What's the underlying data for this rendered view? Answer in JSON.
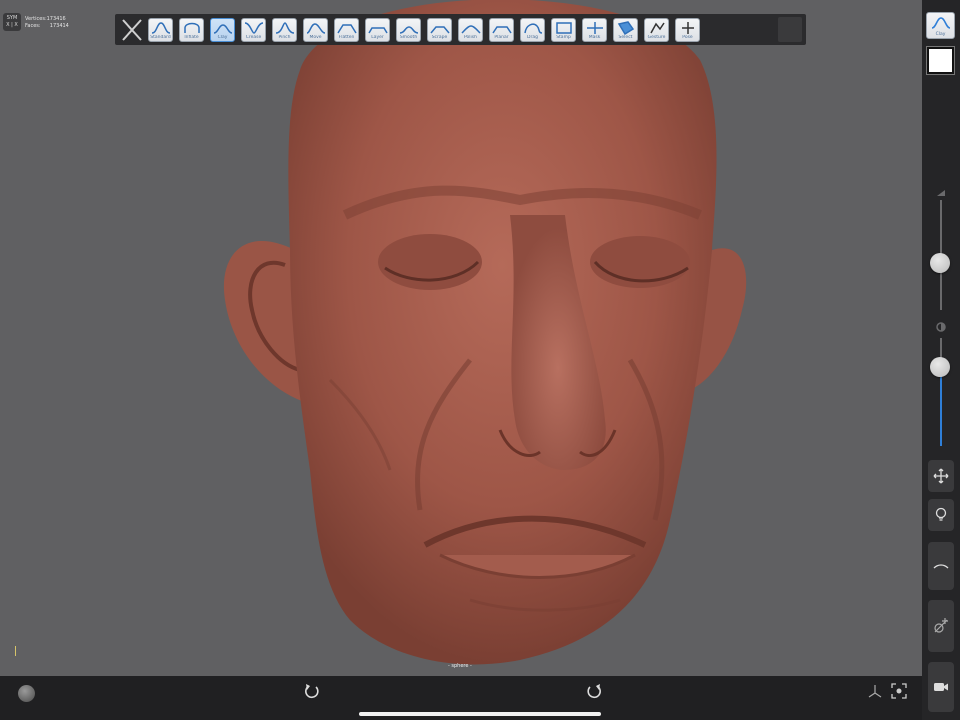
{
  "status": {
    "sym_label": "SYM",
    "sym_axes": "X | X",
    "vertices_label": "Vertices:",
    "vertices_value": "173416",
    "faces_label": "Faces:",
    "faces_value": "173414"
  },
  "toolbar": {
    "tools": [
      {
        "label": "Standard",
        "icon": "standard-curve-icon"
      },
      {
        "label": "Inflate",
        "icon": "inflate-curve-icon"
      },
      {
        "label": "Clay",
        "icon": "clay-curve-icon",
        "active": true
      },
      {
        "label": "Crease",
        "icon": "crease-curve-icon"
      },
      {
        "label": "Pinch",
        "icon": "pinch-curve-icon"
      },
      {
        "label": "Move",
        "icon": "move-curve-icon"
      },
      {
        "label": "Flatten",
        "icon": "flatten-curve-icon"
      },
      {
        "label": "Layer",
        "icon": "layer-curve-icon"
      },
      {
        "label": "Smooth",
        "icon": "smooth-curve-icon"
      },
      {
        "label": "Scrape",
        "icon": "scrape-curve-icon"
      },
      {
        "label": "Polish",
        "icon": "polish-curve-icon"
      },
      {
        "label": "Planar",
        "icon": "planar-curve-icon"
      },
      {
        "label": "Drag",
        "icon": "drag-curve-icon"
      },
      {
        "label": "Stamp",
        "icon": "stamp-icon"
      },
      {
        "label": "Mask",
        "icon": "mask-icon"
      },
      {
        "label": "Select",
        "icon": "select-icon"
      },
      {
        "label": "Gesture",
        "icon": "gesture-icon"
      },
      {
        "label": "Pose",
        "icon": "pose-icon"
      }
    ]
  },
  "rightbar": {
    "current_tool": "Clay",
    "color_hex": "#ffffff",
    "radius_level": 0.43,
    "intensity_level": 0.73
  },
  "viewport": {
    "mesh_name": "- sphere -",
    "model_color": "#a45d4e"
  },
  "colors": {
    "accent": "#2f7fd8",
    "background": "#606062",
    "panel": "#252527"
  }
}
